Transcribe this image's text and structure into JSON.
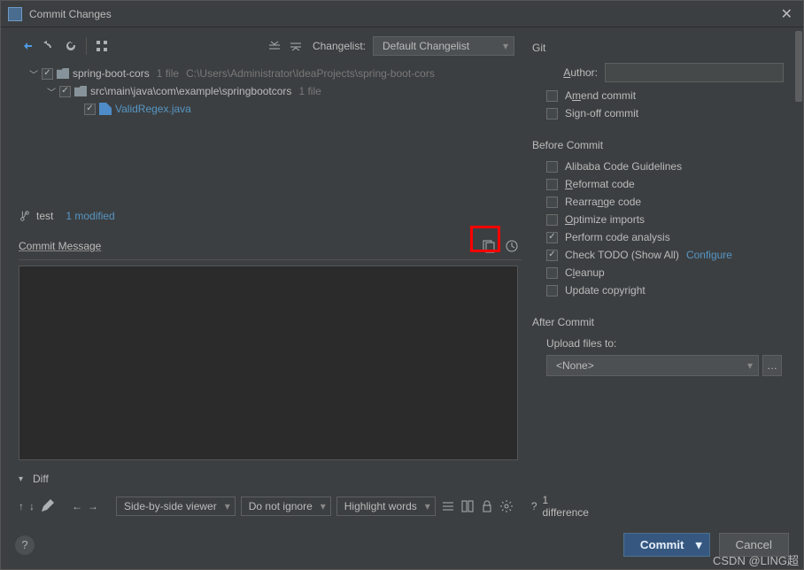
{
  "title": "Commit Changes",
  "toolbar": {
    "changelist_label": "Changelist:",
    "changelist_value": "Default Changelist"
  },
  "tree": {
    "root": {
      "name": "spring-boot-cors",
      "files": "1 file",
      "path": "C:\\Users\\Administrator\\IdeaProjects\\spring-boot-cors"
    },
    "pkg": {
      "name": "src\\main\\java\\com\\example\\springbootcors",
      "files": "1 file"
    },
    "file": {
      "name": "ValidRegex.java"
    }
  },
  "status": {
    "branch": "test",
    "modified": "1 modified"
  },
  "commit_msg_label": "Commit Message",
  "diff": {
    "label": "Diff",
    "viewer": "Side-by-side viewer",
    "ignore": "Do not ignore",
    "highlight": "Highlight words",
    "count": "1 difference"
  },
  "git": {
    "title": "Git",
    "author_label": "Author:",
    "amend": "Amend commit",
    "signoff": "Sign-off commit"
  },
  "before": {
    "title": "Before Commit",
    "items": [
      {
        "label": "Alibaba Code Guidelines",
        "checked": false,
        "u": ""
      },
      {
        "label": "Reformat code",
        "checked": false,
        "u": "R"
      },
      {
        "label": "Rearrange code",
        "checked": false,
        "u": "n"
      },
      {
        "label": "Optimize imports",
        "checked": false,
        "u": "O"
      },
      {
        "label": "Perform code analysis",
        "checked": true,
        "u": ""
      },
      {
        "label": "Check TODO (Show All)",
        "checked": true,
        "u": "",
        "link": "Configure"
      },
      {
        "label": "Cleanup",
        "checked": false,
        "u": "l"
      },
      {
        "label": "Update copyright",
        "checked": false,
        "u": ""
      }
    ]
  },
  "after": {
    "title": "After Commit",
    "upload_label": "Upload files to:",
    "upload_value": "<None>"
  },
  "buttons": {
    "commit": "Commit",
    "cancel": "Cancel"
  },
  "watermark": "CSDN @LING超"
}
